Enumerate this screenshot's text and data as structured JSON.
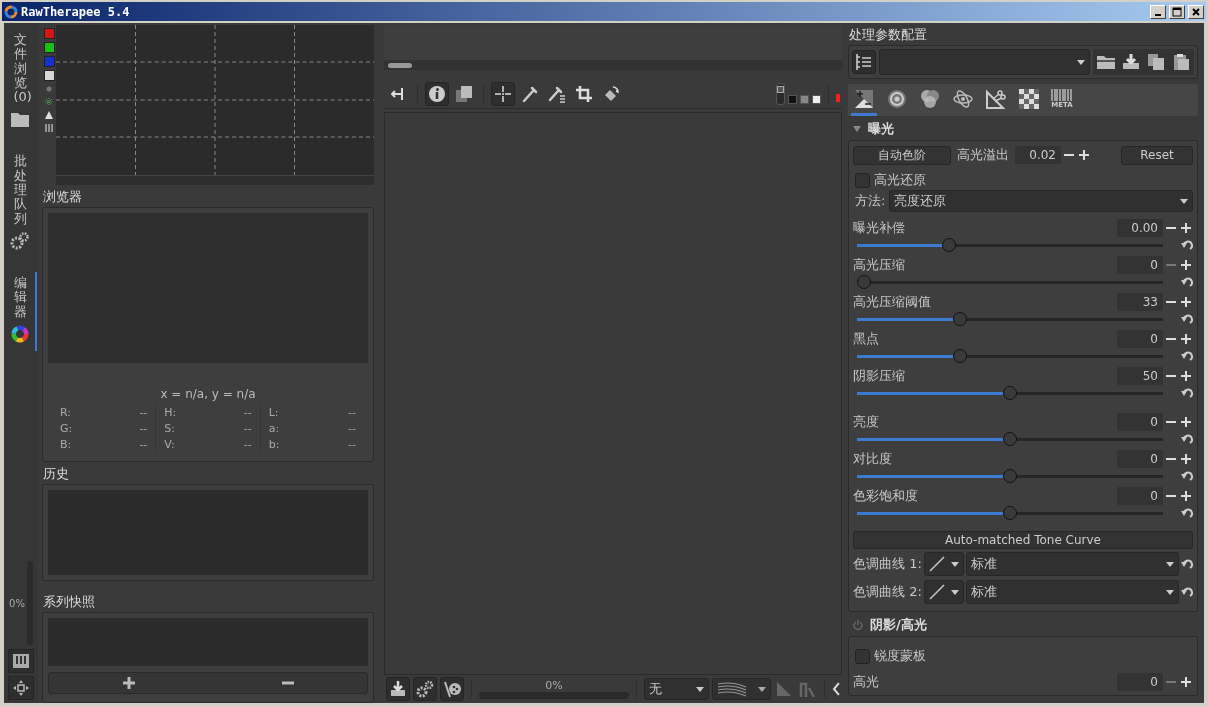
{
  "window": {
    "title": "RawTherapee 5.4"
  },
  "side_tabs": [
    {
      "label": "文件浏览 (0)",
      "kind": "folder",
      "selected": false
    },
    {
      "label": "批处理队列",
      "kind": "gears",
      "selected": false
    },
    {
      "label": "编辑器",
      "kind": "wheel",
      "selected": true
    }
  ],
  "queue_progress": {
    "reading": "0%",
    "level": 0
  },
  "histogram": {
    "channels": [
      {
        "color": "#d01818",
        "on": true
      },
      {
        "color": "#18c018",
        "on": true
      },
      {
        "color": "#1830d0",
        "on": true
      },
      {
        "color": "#d8d8d8",
        "on": true
      }
    ]
  },
  "navigator": {
    "title": "浏览器",
    "coords": "x = n/a, y = n/a",
    "groups": [
      [
        {
          "label": "R:",
          "value": "--"
        },
        {
          "label": "G:",
          "value": "--"
        },
        {
          "label": "B:",
          "value": "--"
        }
      ],
      [
        {
          "label": "H:",
          "value": "--"
        },
        {
          "label": "S:",
          "value": "--"
        },
        {
          "label": "V:",
          "value": "--"
        }
      ],
      [
        {
          "label": "L:",
          "value": "--"
        },
        {
          "label": "a:",
          "value": "--"
        },
        {
          "label": "b:",
          "value": "--"
        }
      ]
    ]
  },
  "history": {
    "title": "历史"
  },
  "snapshots": {
    "title": "系列快照"
  },
  "editor": {
    "progress": {
      "reading": "0%",
      "level": 0
    },
    "preview_combo": "无",
    "split_toggle": {
      "on": false
    }
  },
  "profiles": {
    "title": "处理参数配置"
  },
  "tool_tabs": [
    {
      "kind": "exposure",
      "selected": true
    },
    {
      "kind": "detail",
      "selected": false
    },
    {
      "kind": "color",
      "selected": false
    },
    {
      "kind": "advanced",
      "selected": false
    },
    {
      "kind": "transform",
      "selected": false
    },
    {
      "kind": "raw",
      "selected": false
    },
    {
      "kind": "meta",
      "label": "META",
      "selected": false
    }
  ],
  "exposure": {
    "title": "曝光",
    "expanded": true,
    "auto_levels": "自动色阶",
    "clip_label": "高光溢出",
    "clip_value": "0.02",
    "reset": "Reset",
    "highlight_recovery": {
      "label": "高光还原",
      "checked": false
    },
    "method": {
      "label": "方法:",
      "value": "亮度还原"
    },
    "sliders": [
      {
        "label": "曝光补偿",
        "value": "0.00",
        "level": 0.29
      },
      {
        "label": "高光压缩",
        "value": "0",
        "level": 0
      },
      {
        "label": "高光压缩阈值",
        "value": "33",
        "level": 0.33
      },
      {
        "label": "黑点",
        "value": "0",
        "level": 0.33
      },
      {
        "label": "阴影压缩",
        "value": "50",
        "level": 0.5
      },
      {
        "label": "亮度",
        "value": "0",
        "level": 0.5
      },
      {
        "label": "对比度",
        "value": "0",
        "level": 0.5
      },
      {
        "label": "色彩饱和度",
        "value": "0",
        "level": 0.5
      }
    ],
    "tone_curve_button": "Auto-matched Tone Curve",
    "curves": [
      {
        "label": "色调曲线 1:",
        "value": "标准"
      },
      {
        "label": "色调曲线 2:",
        "value": "标准"
      }
    ]
  },
  "shadows_highlights": {
    "title": "阴影/高光",
    "enabled": false,
    "sharp_mask": {
      "label": "锐度蒙板",
      "checked": false
    },
    "rows": [
      {
        "label": "高光",
        "value": "0"
      }
    ]
  }
}
